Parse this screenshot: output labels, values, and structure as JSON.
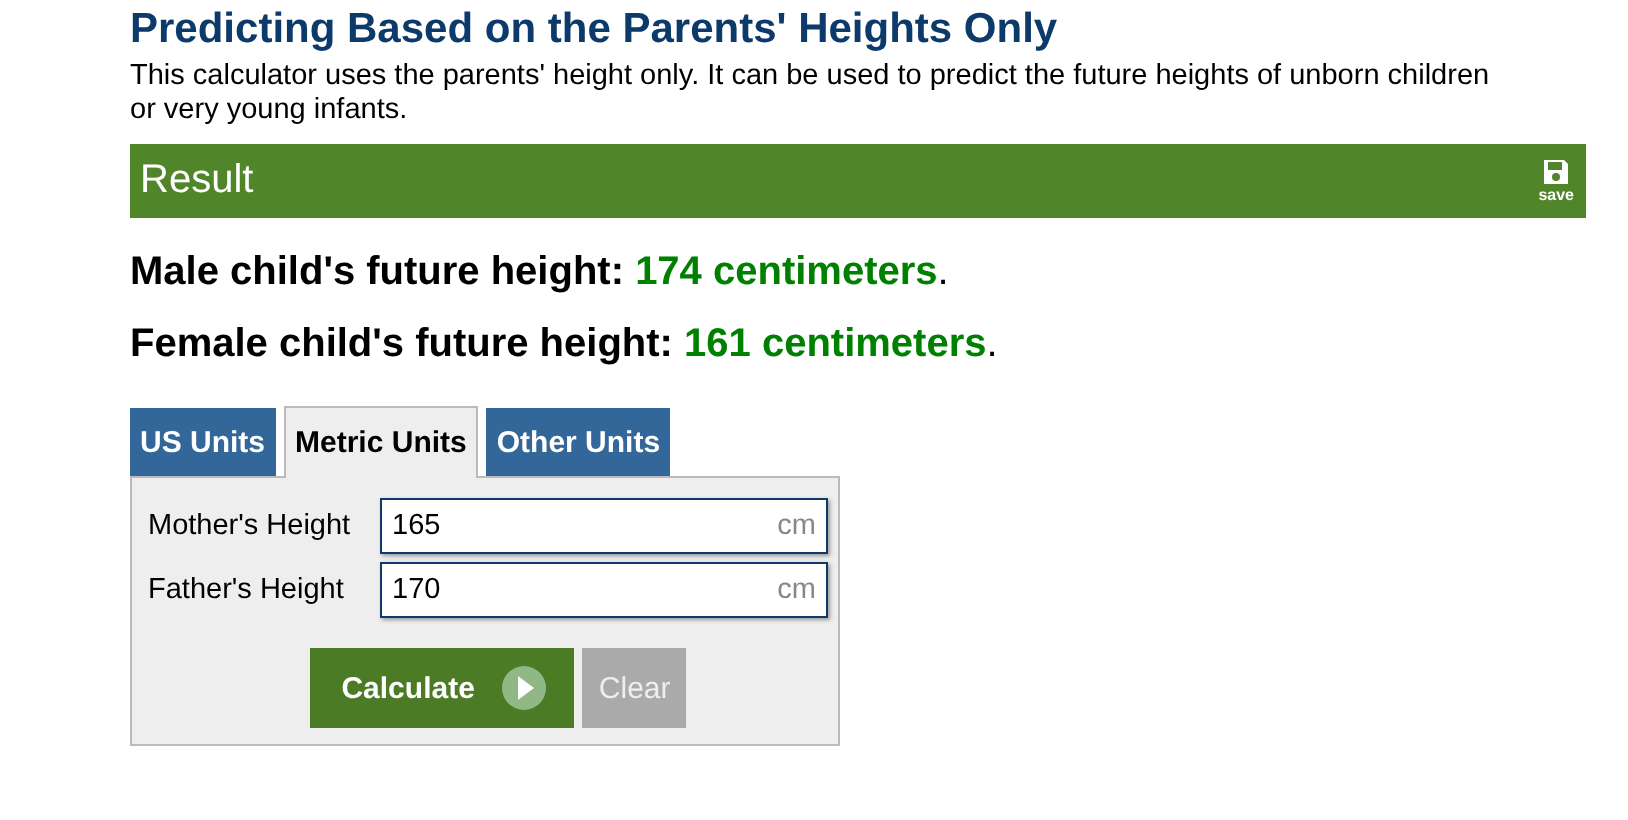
{
  "title": "Predicting Based on the Parents' Heights Only",
  "description": "This calculator uses the parents' height only. It can be used to predict the future heights of unborn children or very young infants.",
  "result_bar": {
    "title": "Result",
    "save_label": "save"
  },
  "results": [
    {
      "label": "Male child's future height:",
      "value": "174 centimeters",
      "suffix": "."
    },
    {
      "label": "Female child's future height:",
      "value": "161 centimeters",
      "suffix": "."
    }
  ],
  "tabs": [
    {
      "label": "US Units",
      "selected": false
    },
    {
      "label": "Metric Units",
      "selected": true
    },
    {
      "label": "Other Units",
      "selected": false
    }
  ],
  "fields": [
    {
      "label": "Mother's Height",
      "value": "165",
      "unit": "cm"
    },
    {
      "label": "Father's Height",
      "value": "170",
      "unit": "cm"
    }
  ],
  "buttons": {
    "calculate": "Calculate",
    "clear": "Clear"
  }
}
